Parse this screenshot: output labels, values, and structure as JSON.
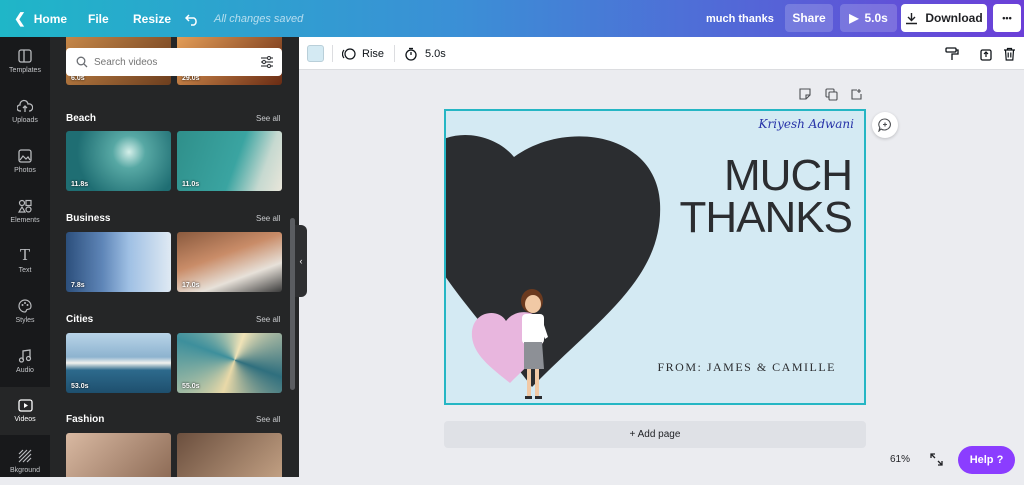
{
  "topbar": {
    "home": "Home",
    "file": "File",
    "resize": "Resize",
    "saved_status": "All changes saved",
    "doc_title": "much thanks",
    "share": "Share",
    "duration": "5.0s",
    "download": "Download",
    "more": "•••"
  },
  "rail": [
    {
      "label": "Templates",
      "icon": "templates-icon"
    },
    {
      "label": "Uploads",
      "icon": "upload-icon"
    },
    {
      "label": "Photos",
      "icon": "photo-icon"
    },
    {
      "label": "Elements",
      "icon": "elements-icon"
    },
    {
      "label": "Text",
      "icon": "text-icon"
    },
    {
      "label": "Styles",
      "icon": "palette-icon"
    },
    {
      "label": "Audio",
      "icon": "music-icon"
    },
    {
      "label": "Videos",
      "icon": "video-icon"
    },
    {
      "label": "Bkground",
      "icon": "background-icon"
    }
  ],
  "panel": {
    "search_placeholder": "Search videos",
    "top_durations": [
      "6.0s",
      "29.0s"
    ],
    "see_all": "See all",
    "sections": [
      {
        "title": "Beach",
        "durations": [
          "11.8s",
          "11.0s"
        ]
      },
      {
        "title": "Business",
        "durations": [
          "7.8s",
          "17.0s"
        ]
      },
      {
        "title": "Cities",
        "durations": [
          "53.0s",
          "55.0s"
        ]
      },
      {
        "title": "Fashion",
        "durations": []
      }
    ]
  },
  "editor_toolbar": {
    "color": "#d4eaf3",
    "animation": "Rise",
    "timing": "5.0s"
  },
  "design": {
    "signature": "Kriyesh Adwani",
    "headline_line1": "MUCH",
    "headline_line2": "THANKS",
    "from_line": "FROM: JAMES & CAMILLE"
  },
  "footer": {
    "add_page": "+ Add page",
    "zoom": "61%",
    "help": "Help ?"
  },
  "colors": {
    "accent": "#8b3dff",
    "canvas_border": "#25b6c4",
    "heart_dark": "#2b2d30",
    "heart_pink": "#e8b6de"
  }
}
